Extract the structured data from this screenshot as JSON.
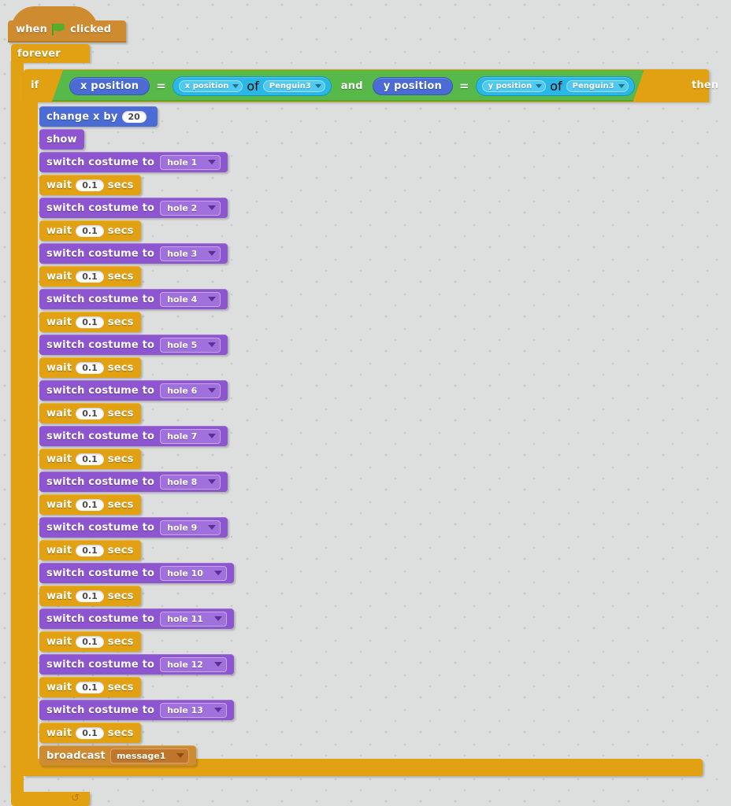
{
  "workspace": {
    "name": "scratch-script-canvas",
    "background_color": "#dddfde"
  },
  "script": {
    "hat": {
      "prefix": "when",
      "icon": "green-flag-icon",
      "suffix": "clicked"
    },
    "forever": {
      "label": "forever",
      "loop_arrow": "↺"
    },
    "if_block": {
      "if_label": "if",
      "then_label": "then",
      "condition": {
        "operator": "and",
        "left": {
          "reporter": "x position",
          "equals": "=",
          "sensing_property": "x position",
          "of_label": "of",
          "sensing_target": "Penguin3"
        },
        "right": {
          "reporter": "y position",
          "equals": "=",
          "sensing_property": "y position",
          "of_label": "of",
          "sensing_target": "Penguin3"
        }
      }
    },
    "stack": [
      {
        "category": "motion",
        "name": "change-x-by-block",
        "prefix": "change x  by",
        "value": "20",
        "suffix": ""
      },
      {
        "category": "looks",
        "name": "show-block",
        "prefix": "show",
        "value": null,
        "suffix": ""
      },
      {
        "category": "looks",
        "name": "switch-costume-block",
        "prefix": "switch costume to",
        "dropdown": "hole 1"
      },
      {
        "category": "control",
        "name": "wait-block",
        "prefix": "wait",
        "value": "0.1",
        "suffix": "secs"
      },
      {
        "category": "looks",
        "name": "switch-costume-block",
        "prefix": "switch costume to",
        "dropdown": "hole 2"
      },
      {
        "category": "control",
        "name": "wait-block",
        "prefix": "wait",
        "value": "0.1",
        "suffix": "secs"
      },
      {
        "category": "looks",
        "name": "switch-costume-block",
        "prefix": "switch costume to",
        "dropdown": "hole 3"
      },
      {
        "category": "control",
        "name": "wait-block",
        "prefix": "wait",
        "value": "0.1",
        "suffix": "secs"
      },
      {
        "category": "looks",
        "name": "switch-costume-block",
        "prefix": "switch costume to",
        "dropdown": "hole 4"
      },
      {
        "category": "control",
        "name": "wait-block",
        "prefix": "wait",
        "value": "0.1",
        "suffix": "secs"
      },
      {
        "category": "looks",
        "name": "switch-costume-block",
        "prefix": "switch costume to",
        "dropdown": "hole 5"
      },
      {
        "category": "control",
        "name": "wait-block",
        "prefix": "wait",
        "value": "0.1",
        "suffix": "secs"
      },
      {
        "category": "looks",
        "name": "switch-costume-block",
        "prefix": "switch costume to",
        "dropdown": "hole 6"
      },
      {
        "category": "control",
        "name": "wait-block",
        "prefix": "wait",
        "value": "0.1",
        "suffix": "secs"
      },
      {
        "category": "looks",
        "name": "switch-costume-block",
        "prefix": "switch costume to",
        "dropdown": "hole 7"
      },
      {
        "category": "control",
        "name": "wait-block",
        "prefix": "wait",
        "value": "0.1",
        "suffix": "secs"
      },
      {
        "category": "looks",
        "name": "switch-costume-block",
        "prefix": "switch costume to",
        "dropdown": "hole 8"
      },
      {
        "category": "control",
        "name": "wait-block",
        "prefix": "wait",
        "value": "0.1",
        "suffix": "secs"
      },
      {
        "category": "looks",
        "name": "switch-costume-block",
        "prefix": "switch costume to",
        "dropdown": "hole 9"
      },
      {
        "category": "control",
        "name": "wait-block",
        "prefix": "wait",
        "value": "0.1",
        "suffix": "secs"
      },
      {
        "category": "looks",
        "name": "switch-costume-block",
        "prefix": "switch costume to",
        "dropdown": "hole 10"
      },
      {
        "category": "control",
        "name": "wait-block",
        "prefix": "wait",
        "value": "0.1",
        "suffix": "secs"
      },
      {
        "category": "looks",
        "name": "switch-costume-block",
        "prefix": "switch costume to",
        "dropdown": "hole 11"
      },
      {
        "category": "control",
        "name": "wait-block",
        "prefix": "wait",
        "value": "0.1",
        "suffix": "secs"
      },
      {
        "category": "looks",
        "name": "switch-costume-block",
        "prefix": "switch costume to",
        "dropdown": "hole 12"
      },
      {
        "category": "control",
        "name": "wait-block",
        "prefix": "wait",
        "value": "0.1",
        "suffix": "secs"
      },
      {
        "category": "looks",
        "name": "switch-costume-block",
        "prefix": "switch costume to",
        "dropdown": "hole 13"
      },
      {
        "category": "control",
        "name": "wait-block",
        "prefix": "wait",
        "value": "0.1",
        "suffix": "secs"
      },
      {
        "category": "events",
        "name": "broadcast-block",
        "prefix": "broadcast",
        "dropdown": "message1"
      }
    ],
    "colors": {
      "motion": "#4a6cd4",
      "looks": "#8e55d0",
      "control": "#e2a112",
      "events": "#cf8b30",
      "operators": "#56b949",
      "sensing": "#29b8e5",
      "hat": "#cf8b30"
    }
  }
}
